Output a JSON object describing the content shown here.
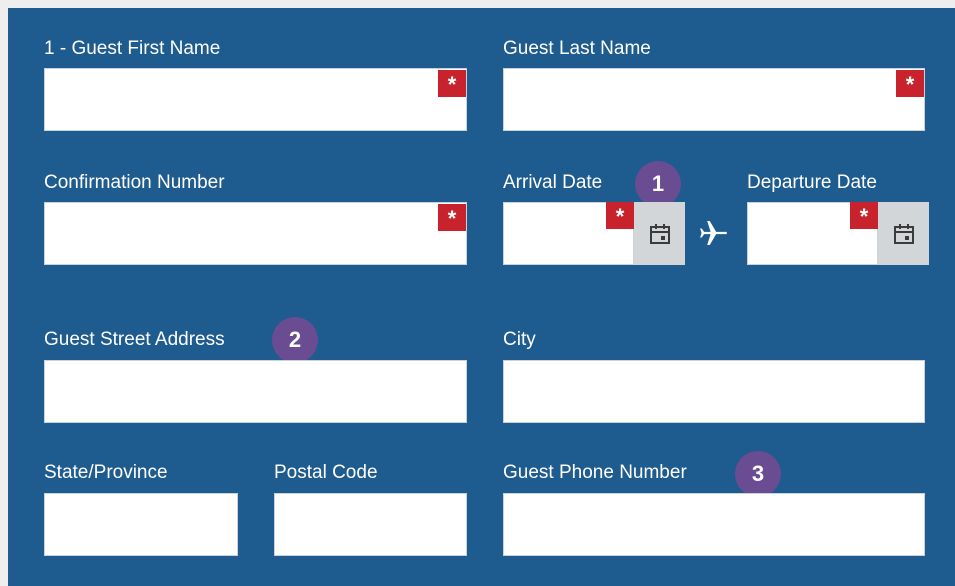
{
  "form": {
    "first_name": {
      "label": "1 - Guest First Name",
      "value": "",
      "required_mark": "*"
    },
    "last_name": {
      "label": "Guest Last Name",
      "value": "",
      "required_mark": "*"
    },
    "confirmation": {
      "label": "Confirmation Number",
      "value": "",
      "required_mark": "*"
    },
    "arrival": {
      "label": "Arrival Date",
      "value": "",
      "required_mark": "*",
      "icon": "calendar-icon"
    },
    "departure": {
      "label": "Departure Date",
      "value": "",
      "required_mark": "*",
      "icon": "calendar-icon"
    },
    "trip_icon": "airplane-icon",
    "street": {
      "label": "Guest Street Address",
      "value": ""
    },
    "city": {
      "label": "City",
      "value": ""
    },
    "state": {
      "label": "State/Province",
      "value": ""
    },
    "postal": {
      "label": "Postal Code",
      "value": ""
    },
    "phone": {
      "label": "Guest Phone Number",
      "value": ""
    }
  },
  "callouts": [
    "1",
    "2",
    "3"
  ],
  "colors": {
    "panel_bg": "#1e5b8e",
    "required": "#c8232c",
    "callout": "#6a4c93",
    "calendar_button": "#d3d6d9"
  }
}
